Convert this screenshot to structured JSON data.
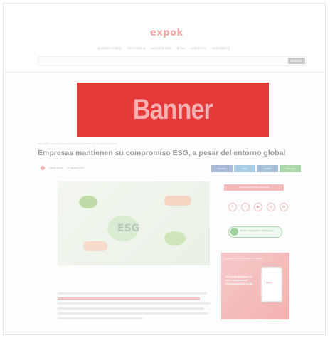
{
  "header": {
    "logo": "expok",
    "nav": [
      "QUIENES SOMOS",
      "SECTORES ▾",
      "DIFUSIÓN ESG",
      "BLOG",
      "CONTACTO",
      "SUSCRÍBETE"
    ],
    "search_button": "BUSCAR"
  },
  "banner": {
    "label": "Banner"
  },
  "article": {
    "breadcrumb": "Inicio › ESG › Empresas mantienen su compromiso ESG, a pesar del entorno global",
    "title": "Empresas mantienen su compromiso ESG, a pesar del entorno global",
    "author": "Expok News",
    "date": "10 agosto 2023"
  },
  "share": [
    {
      "label": "Facebook",
      "color": "#a7b8d6"
    },
    {
      "label": "Twitter",
      "color": "#a9cde6"
    },
    {
      "label": "LinkedIn",
      "color": "#a5c0d8"
    },
    {
      "label": "WhatsApp",
      "color": "#a8d8a8"
    }
  ],
  "hero": {
    "label": "ESG"
  },
  "sidebar": {
    "tag": "Las noticias de ESG más leídas",
    "socials": [
      "f",
      "t",
      "▶",
      "◎",
      "in"
    ],
    "whatsapp": "Recibe noticias ESG vía WhatsApp",
    "ad": {
      "top": "¿Te gusta ver las noticias en tu celular?",
      "text": "En Expok lanzamos 10 años comunicando responsabilidad social.",
      "phone_logo": "expok"
    }
  }
}
